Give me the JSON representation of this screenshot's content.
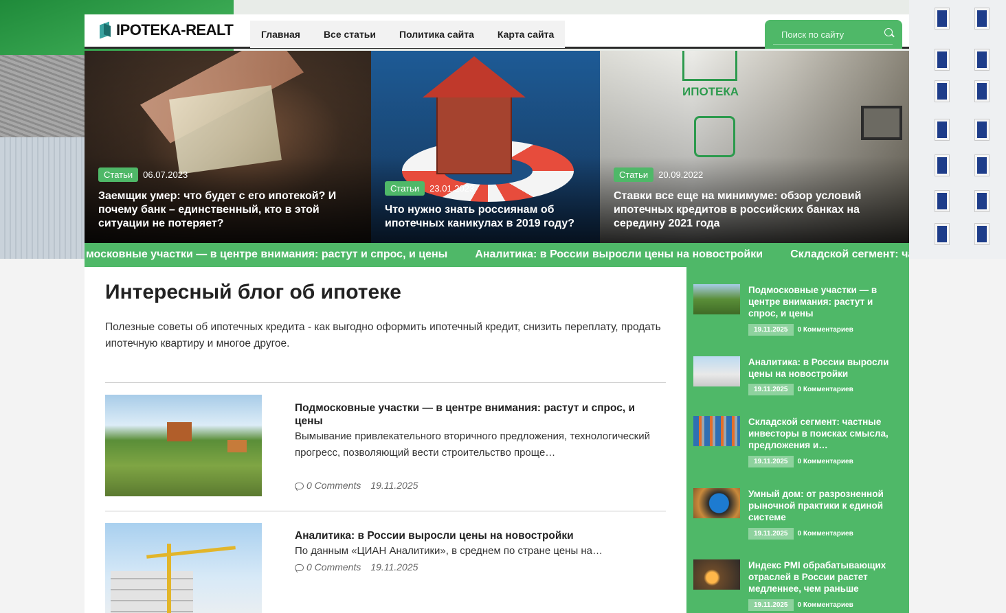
{
  "site": {
    "logo": "IPOTEKA-REALT"
  },
  "nav": [
    {
      "label": "Главная"
    },
    {
      "label": "Все статьи"
    },
    {
      "label": "Политика сайта"
    },
    {
      "label": "Карта сайта"
    }
  ],
  "search": {
    "placeholder": "Поиск по сайту"
  },
  "featured": [
    {
      "tag": "Статьи",
      "date": "06.07.2023",
      "title": "Заемщик умер: что будет с его ипотекой? И почему банк – единственный, кто в этой ситуации не потеряет?"
    },
    {
      "tag": "Статьи",
      "date": "23.01.2023",
      "title": "Что нужно знать россиянам об ипотечных каникулах в 2019 году?"
    },
    {
      "tag": "Статьи",
      "date": "20.09.2022",
      "title": "Ставки все еще на минимуме: обзор условий ипотечных кредитов в российских банках на середину 2021 года",
      "image_text": "ИПОТЕКА"
    }
  ],
  "ticker": [
    "московные участки — в центре внимания: растут и спрос, и цены",
    "Аналитика: в России выросли цены на новостройки",
    "Складской сегмент: частные инвесторы в поисках смысла, предложения и доходности"
  ],
  "main": {
    "title": "Интересный блог об ипотеке",
    "intro": "Полезные советы об ипотечных кредита - как выгодно оформить ипотечный кредит, снизить переплату, продать ипотечную квартиру и многое другое.",
    "posts": [
      {
        "title": "Подмосковные участки — в центре внимания: растут и спрос, и цены",
        "excerpt": "Вымывание привлекательного вторичного предложения, технологический прогресс, позволяющий вести строительство проще…",
        "comments": "0 Comments",
        "date": "19.11.2025"
      },
      {
        "title": "Аналитика: в России выросли цены на новостройки",
        "excerpt": "По данным «ЦИАН Аналитики», в среднем по стране цены на…",
        "comments": "0 Comments",
        "date": "19.11.2025"
      }
    ]
  },
  "sidebar": {
    "items": [
      {
        "title": "Подмосковные участки — в центре внимания: растут и спрос, и цены",
        "date": "19.11.2025",
        "comments": "0 Комментариев"
      },
      {
        "title": "Аналитика: в России выросли цены на новостройки",
        "date": "19.11.2025",
        "comments": "0 Комментариев"
      },
      {
        "title": "Складской сегмент: частные инвесторы в поисках смысла, предложения и…",
        "date": "19.11.2025",
        "comments": "0 Комментариев"
      },
      {
        "title": "Умный дом: от разрозненной рыночной практики к единой системе",
        "date": "19.11.2025",
        "comments": "0 Комментариев"
      },
      {
        "title": "Индекс PMI обрабатывающих отраслей в России растет медленнее, чем раньше",
        "date": "19.11.2025",
        "comments": "0 Комментариев"
      }
    ]
  },
  "colors": {
    "accent": "#4fb868",
    "dark": "#222222"
  }
}
